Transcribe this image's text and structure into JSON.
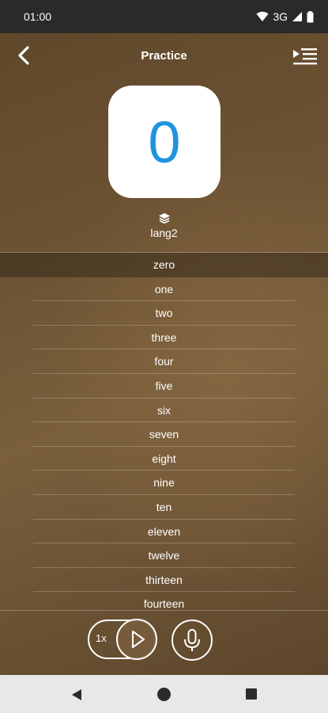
{
  "status_bar": {
    "time": "01:00",
    "network": "3G"
  },
  "header": {
    "title": "Practice"
  },
  "card": {
    "digit": "0"
  },
  "language": {
    "label": "lang2"
  },
  "words": [
    "zero",
    "one",
    "two",
    "three",
    "four",
    "five",
    "six",
    "seven",
    "eight",
    "nine",
    "ten",
    "eleven",
    "twelve",
    "thirteen",
    "fourteen"
  ],
  "selected_index": 0,
  "controls": {
    "speed_label": "1x"
  },
  "colors": {
    "accent": "#1f93e0",
    "status_bar": "#2b2a28",
    "nav_bar": "#e8e8e8"
  },
  "icons": {
    "back": "chevron-left-icon",
    "playlist": "playlist-play-icon",
    "language": "layers-icon",
    "play": "play-icon",
    "mic": "microphone-icon"
  }
}
